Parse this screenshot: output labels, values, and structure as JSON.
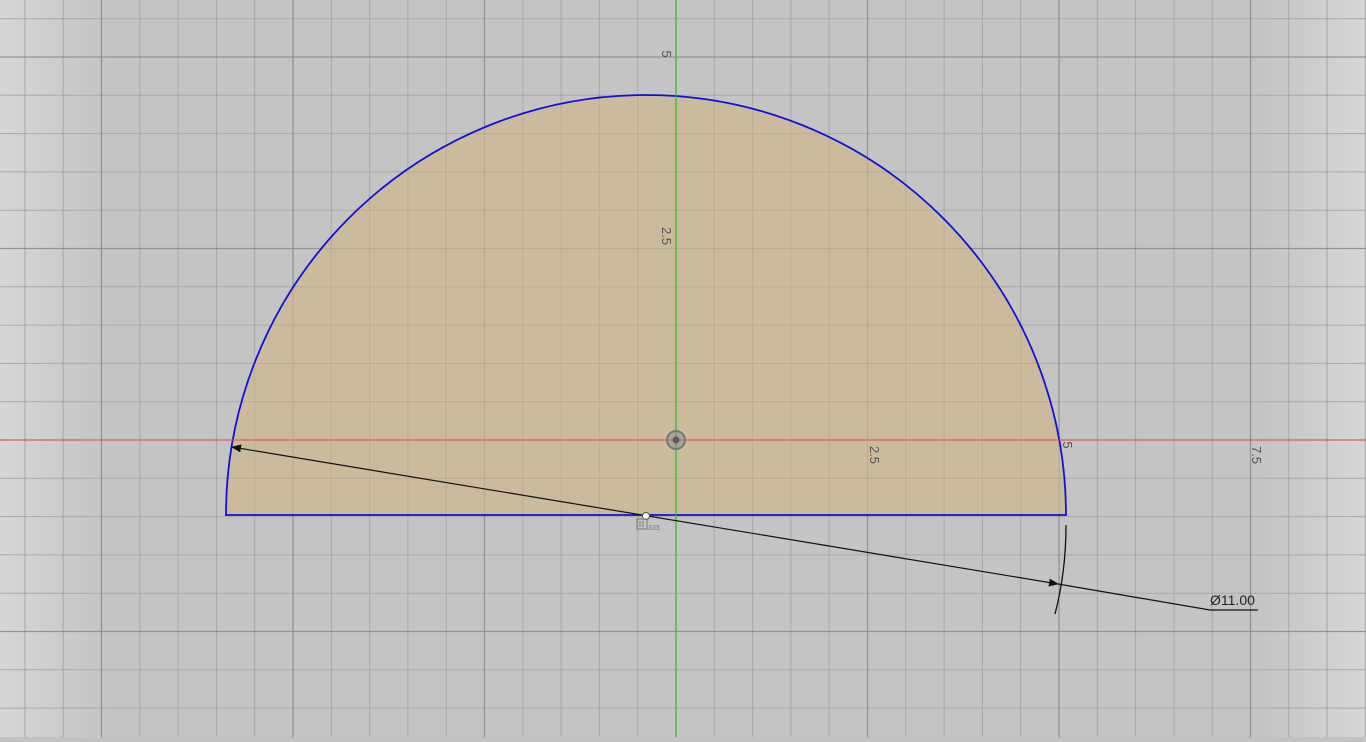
{
  "app": {
    "view": "sketch-canvas"
  },
  "grid": {
    "axis_labels": {
      "y_5": "5",
      "y_2_5": "2.5",
      "x_2_5": "2.5",
      "x_5": "5",
      "x_7_5": "7.5"
    }
  },
  "sketch": {
    "profile_fill_color": "#cbb898",
    "profile_stroke_color": "#1010e0",
    "x_axis_color": "#e05050",
    "y_axis_color": "#30c030"
  },
  "dimension": {
    "diameter_text": "Ø11.00"
  },
  "icons": {
    "origin": "origin-point-icon",
    "constraint": "constraint-glyph-icon"
  }
}
